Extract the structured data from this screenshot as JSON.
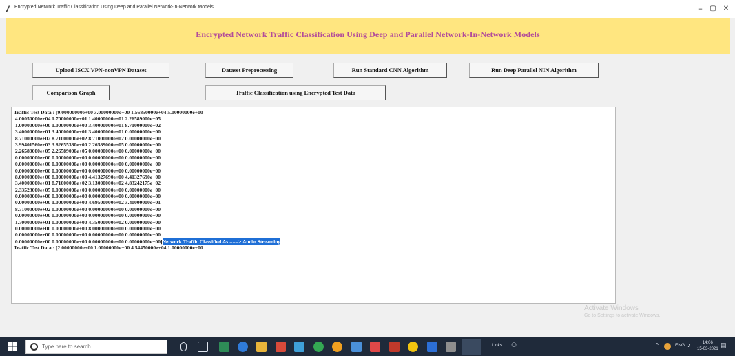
{
  "window": {
    "title": "Encrypted Network Traffic Classification Using Deep and Parallel Network-In-Network Models",
    "minimize": "–",
    "maximize": "▢",
    "close": "✕"
  },
  "header": {
    "heading": "Encrypted Network Traffic Classification Using Deep and Parallel Network-In-Network Models",
    "color": "#ffe680",
    "heading_color": "#b34c9a"
  },
  "buttons": {
    "upload": "Upload ISCX VPN-nonVPN Dataset",
    "preprocess": "Dataset Preprocessing",
    "run_cnn": "Run Standard CNN Algorithm",
    "run_nin": "Run Deep Parallel NIN Algorithm",
    "comparison": "Comparison Graph",
    "classify": "Traffic Classification using Encrypted Test Data"
  },
  "output": {
    "lines": [
      "Traffic Test Data : [9.00000000e+00 3.00000000e+00 1.56850000e+04 5.00000000e+00",
      " 4.00050000e+04 1.70000000e+01 1.40000000e+01 2.26589000e+05",
      " 1.00000000e+00 1.00000000e+00 3.40000000e+01 8.71000000e+02",
      " 3.40000000e+01 3.40000000e+01 3.40000000e+01 0.00000000e+00",
      " 8.71000000e+02 8.71000000e+02 8.71000000e+02 0.00000000e+00",
      " 3.99401560e+03 3.82655380e+00 2.26589000e+05 0.00000000e+00",
      " 2.26589000e+05 2.26589000e+05 0.00000000e+00 0.00000000e+00",
      " 0.00000000e+00 0.00000000e+00 0.00000000e+00 0.00000000e+00",
      " 0.00000000e+00 0.00000000e+00 0.00000000e+00 0.00000000e+00",
      " 0.00000000e+00 0.00000000e+00 0.00000000e+00 0.00000000e+00",
      " 8.00000000e+00 8.00000000e+00 4.41327690e+00 4.41327690e+00",
      " 3.40000000e+01 8.71000000e+02 3.13000000e+02 4.83242175e+02",
      " 2.33523000e+05 0.00000000e+00 0.00000000e+00 0.00000000e+00",
      " 0.00000000e+00 0.00000000e+00 0.00000000e+00 0.00000000e+00",
      " 0.00000000e+00 1.00000000e+00 4.69500000e+02 3.40000000e+01",
      " 8.71000000e+02 0.00000000e+00 0.00000000e+00 0.00000000e+00",
      " 0.00000000e+00 0.00000000e+00 0.00000000e+00 0.00000000e+00",
      " 1.70000000e+01 0.00000000e+00 4.35000000e+02 0.00000000e+00",
      " 0.00000000e+00 0.00000000e+00 8.00000000e+00 0.00000000e+00",
      " 0.00000000e+00 0.00000000e+00 0.00000000e+00 0.00000000e+00"
    ],
    "last_prefix": " 0.00000000e+00 0.00000000e+00 0.00000000e+00 0.00000000e+00]",
    "result_selected": "Network Traffic Classified As ===> Audio Streaming",
    "next_line": "Traffic Test Data : [2.00000000e+00 1.00000000e+00 4.54450000e+04 1.00000000e+00",
    "selection_color": "#1f6fd6"
  },
  "watermark": {
    "line1": "Activate Windows",
    "line2": "Go to Settings to activate Windows."
  },
  "taskbar": {
    "search_placeholder": "Type here to search",
    "tray_lang": "Links",
    "tray_eng": "ENG",
    "time": "14:06",
    "date": "15-03-2021"
  }
}
